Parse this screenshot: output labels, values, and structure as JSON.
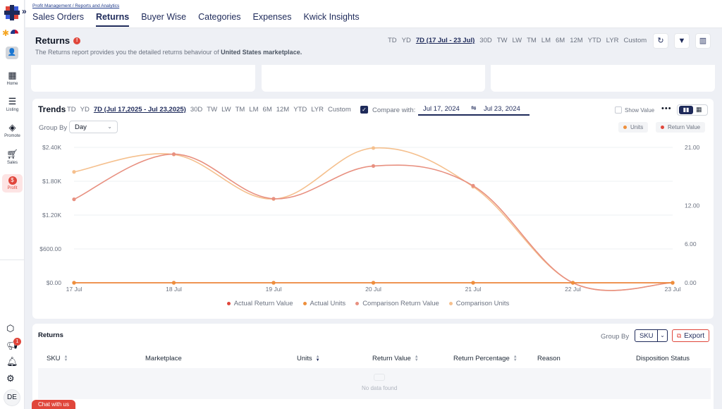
{
  "breadcrumb": "Profit Management / Reports and Analytics",
  "nav_tabs": [
    {
      "label": "Sales Orders",
      "active": false
    },
    {
      "label": "Returns",
      "active": true
    },
    {
      "label": "Buyer Wise",
      "active": false
    },
    {
      "label": "Categories",
      "active": false
    },
    {
      "label": "Expenses",
      "active": false
    },
    {
      "label": "Kwick Insights",
      "active": false
    }
  ],
  "sidebar": {
    "user_initial": "",
    "items": [
      {
        "label": "Home",
        "icon": "home-icon"
      },
      {
        "label": "Listing",
        "icon": "listing-icon"
      },
      {
        "label": "Promote",
        "icon": "promote-icon"
      },
      {
        "label": "Sales",
        "icon": "cart-icon"
      },
      {
        "label": "Profit",
        "icon": "dollar-icon",
        "active": true
      }
    ],
    "notification_count": "1",
    "avatar_initials": "DE"
  },
  "header": {
    "title": "Returns",
    "info": "!",
    "description_prefix": "The Returns report provides you the detailed returns behaviour of ",
    "description_marketplace": "United States marketplace."
  },
  "period_options": [
    "TD",
    "YD",
    "7D (17 Jul - 23 Jul)",
    "30D",
    "TW",
    "LW",
    "TM",
    "LM",
    "6M",
    "12M",
    "YTD",
    "LYR",
    "Custom"
  ],
  "period_selected_index": 2,
  "trends": {
    "title": "Trends",
    "period_options": [
      "TD",
      "YD",
      "7D (Jul 17,2025 - Jul 23,2025)",
      "30D",
      "TW",
      "LW",
      "TM",
      "LM",
      "6M",
      "12M",
      "YTD",
      "LYR",
      "Custom"
    ],
    "period_selected_index": 2,
    "compare_label": "Compare with:",
    "compare_checked": true,
    "compare_start": "Jul 17, 2024",
    "compare_swap": "⇋",
    "compare_end": "Jul 23, 2024",
    "show_value_label": "Show Value",
    "group_by_label": "Group By",
    "group_by_value": "Day",
    "metric_buttons": [
      {
        "label": "Units",
        "color": "#ee8f3b"
      },
      {
        "label": "Return Value",
        "color": "#e0463b"
      }
    ]
  },
  "chart_data": {
    "type": "line",
    "x": [
      "17 Jul",
      "18 Jul",
      "19 Jul",
      "20 Jul",
      "21 Jul",
      "22 Jul",
      "23 Jul"
    ],
    "y_left_ticks": [
      "$0.00",
      "$600.00",
      "$1.20K",
      "$1.80K",
      "$2.40K"
    ],
    "y_right_ticks": [
      "0.00",
      "6.00",
      "12.00",
      "21.00"
    ],
    "ylim_left": [
      0,
      2400
    ],
    "ylim_right": [
      0,
      21
    ],
    "series": [
      {
        "name": "Actual Return Value",
        "axis": "left",
        "color": "#e0463b",
        "values": [
          0,
          0,
          0,
          0,
          0,
          0,
          0
        ]
      },
      {
        "name": "Actual Units",
        "axis": "right",
        "color": "#ee8f3b",
        "values": [
          0,
          0,
          0,
          0,
          0,
          0,
          0
        ]
      },
      {
        "name": "Comparison Return Value",
        "axis": "left",
        "color": "#e89080",
        "values": [
          1480,
          2280,
          1490,
          2070,
          1720,
          0,
          0
        ]
      },
      {
        "name": "Comparison Units",
        "axis": "right",
        "color": "#f5c08e",
        "values": [
          17.2,
          19.9,
          13.0,
          20.9,
          14.9,
          0,
          0
        ]
      }
    ],
    "grid": true,
    "legend_position": "bottom"
  },
  "returns_table": {
    "title": "Returns",
    "group_by_label": "Group By",
    "group_by_value": "SKU",
    "export_label": "Export",
    "columns": [
      "SKU",
      "Marketplace",
      "Units",
      "Return Value",
      "Return Percentage",
      "Reason",
      "Disposition Status"
    ],
    "empty_text": "No data found"
  },
  "chat_label": "Chat with us"
}
